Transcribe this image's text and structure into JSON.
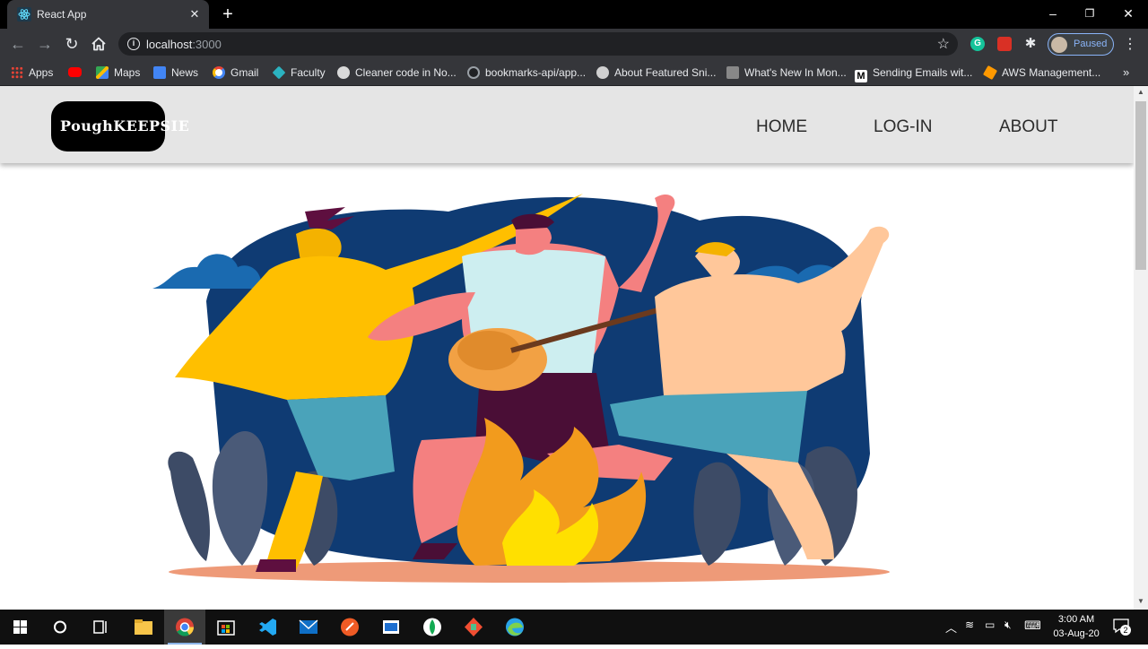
{
  "browser": {
    "tab_title": "React App",
    "url_host": "localhost",
    "url_port": ":3000",
    "profile_label": "Paused",
    "window_controls": {
      "minimize": "–",
      "maximize": "❐",
      "close": "✕"
    }
  },
  "bookmarks": [
    {
      "label": "Apps",
      "icon": "apps-grid-icon",
      "color": "#e8453c"
    },
    {
      "label": "",
      "icon": "youtube-icon",
      "color": "#ff0000"
    },
    {
      "label": "Maps",
      "icon": "maps-icon",
      "color": "#34a853"
    },
    {
      "label": "News",
      "icon": "news-icon",
      "color": "#4285f4"
    },
    {
      "label": "Gmail",
      "icon": "google-icon",
      "color": "#ffffff"
    },
    {
      "label": "Faculty",
      "icon": "faculty-icon",
      "color": "#2bb3c0"
    },
    {
      "label": "Cleaner code in No...",
      "icon": "cleaner-code-icon",
      "color": "#d9d9d9"
    },
    {
      "label": "bookmarks-api/app...",
      "icon": "github-icon",
      "color": "#444444"
    },
    {
      "label": "About Featured Sni...",
      "icon": "globe-icon",
      "color": "#d0d0d0"
    },
    {
      "label": "What's New In Mon...",
      "icon": "mongo-icon",
      "color": "#888888"
    },
    {
      "label": "Sending Emails wit...",
      "icon": "medium-icon",
      "color": "#ffffff"
    },
    {
      "label": "AWS Management...",
      "icon": "aws-icon",
      "color": "#ff9900"
    }
  ],
  "site": {
    "logo_text": "PoughKEEPSIE",
    "nav": [
      "HOME",
      "LOG-IN",
      "ABOUT"
    ]
  },
  "taskbar": {
    "apps": [
      "windows-start-icon",
      "cortana-icon",
      "task-view-icon",
      "file-explorer-icon",
      "chrome-icon",
      "store-icon",
      "vscode-icon",
      "mail-icon",
      "postman-icon",
      "app-icon",
      "mongodb-compass-icon",
      "git-icon",
      "edge-icon"
    ],
    "time": "3:00 AM",
    "date": "03-Aug-20",
    "notification_count": "2"
  }
}
